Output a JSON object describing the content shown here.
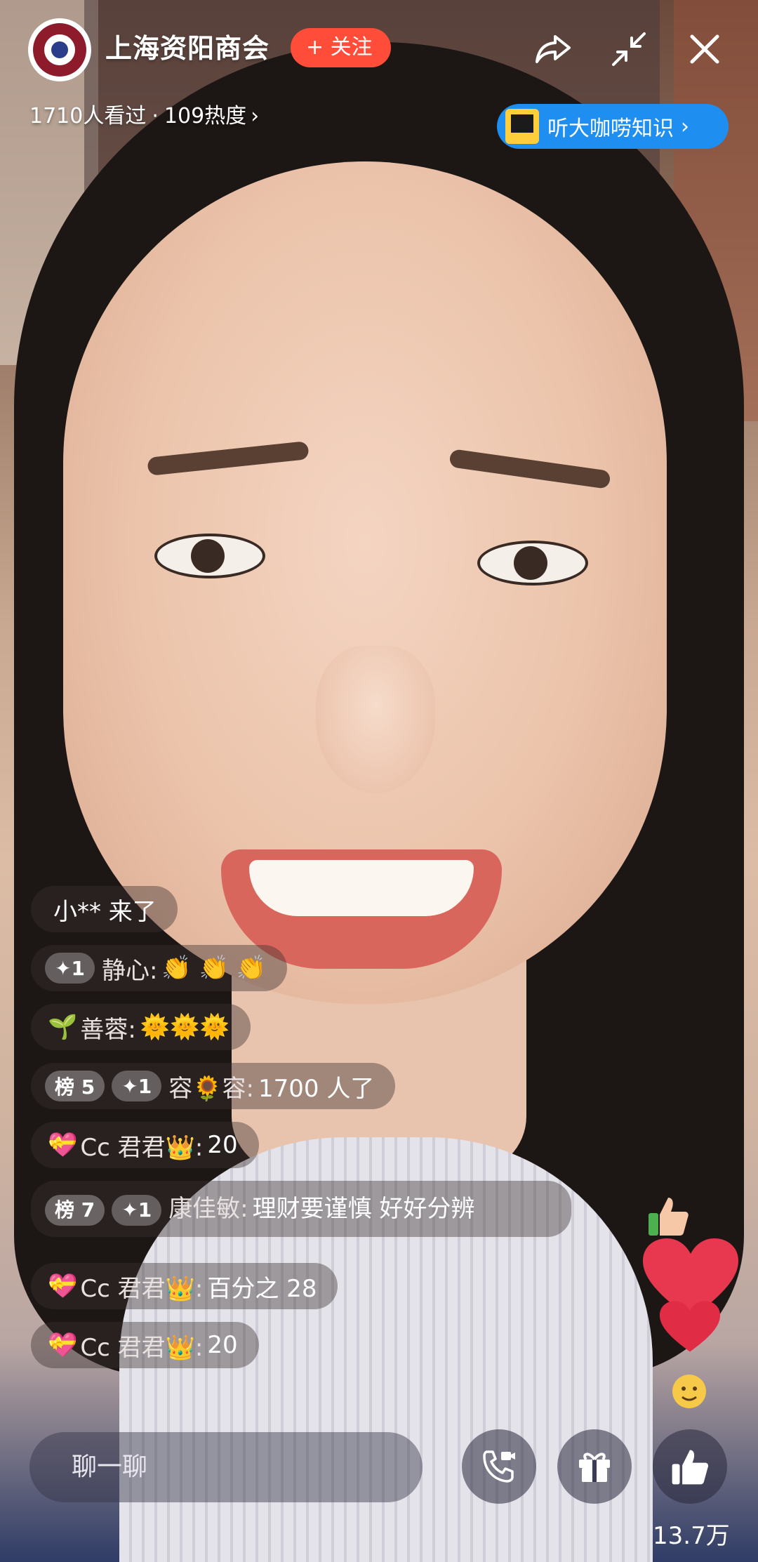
{
  "header": {
    "room_title": "上海资阳商会",
    "follow_label": "+ 关注",
    "viewers": "1710人看过",
    "separator": "·",
    "heat": "109热度",
    "chevron": "›",
    "listen_label": "听大咖唠知识",
    "listen_chevron": "›"
  },
  "icons": {
    "share": "share-icon",
    "minimize": "minimize-icon",
    "close": "close-icon",
    "video_call": "video-call-icon",
    "gift": "gift-icon",
    "like": "thumbs-up-icon"
  },
  "chat": {
    "join_message": "小** 来了",
    "messages": [
      {
        "badge_star": "✦1",
        "name": "静心:",
        "msg": "👏 👏 👏"
      },
      {
        "prefix": "🌱",
        "name": "善蓉:",
        "msg": "🌞🌞🌞"
      },
      {
        "badge_rank": "榜 5",
        "badge_star": "✦1",
        "name": "容🌻容:",
        "msg": "1700 人了"
      },
      {
        "prefix": "💝",
        "name": "Cc 君君👑:",
        "msg": "20"
      },
      {
        "badge_rank": "榜 7",
        "badge_star": "✦1",
        "name": "康佳敏:",
        "msg": "理财要谨慎 好好分辨"
      },
      {
        "prefix": "💝",
        "name": "Cc 君君👑:",
        "msg": "百分之 28"
      },
      {
        "prefix": "💝",
        "name": "Cc 君君👑:",
        "msg": "20"
      }
    ]
  },
  "footer": {
    "chat_placeholder": "聊一聊",
    "like_count": "13.7万"
  },
  "colors": {
    "follow": "#ff4d3a",
    "listen_chip": "#1e8ff0",
    "heart": "#e8384f"
  }
}
